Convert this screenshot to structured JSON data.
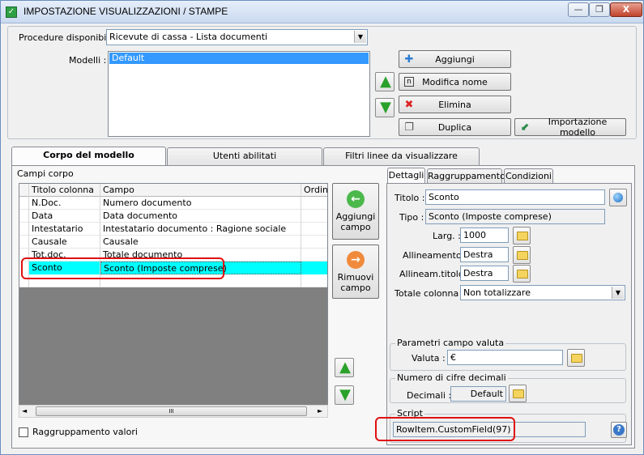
{
  "window": {
    "title": "IMPOSTAZIONE VISUALIZZAZIONI / STAMPE",
    "minimize_glyph": "—",
    "restore_glyph": "❐",
    "close_glyph": "X"
  },
  "top": {
    "procedure_label": "Procedure disponibili :",
    "procedure_value": "Ricevute di cassa - Lista documenti",
    "models_label": "Modelli :",
    "models": [
      "Default"
    ],
    "buttons": {
      "add": "Aggiungi",
      "rename": "Modifica nome",
      "delete": "Elimina",
      "duplicate": "Duplica",
      "import": "Importazione modello"
    }
  },
  "tabs": [
    "Corpo del modello",
    "Utenti abilitati",
    "Filtri linee da visualizzare"
  ],
  "body": {
    "fields_label": "Campi corpo",
    "columns": [
      "Titolo colonna",
      "Campo",
      "Ordina"
    ],
    "rows": [
      {
        "title": "N.Doc.",
        "field": "Numero documento"
      },
      {
        "title": "Data",
        "field": "Data documento"
      },
      {
        "title": "Intestatario",
        "field": "Intestatario documento : Ragione sociale"
      },
      {
        "title": "Causale",
        "field": "Causale"
      },
      {
        "title": "Tot.doc.",
        "field": "Totale documento"
      },
      {
        "title": "Sconto",
        "field": "Sconto (Imposte comprese)"
      }
    ],
    "add_field_line1": "Aggiungi",
    "add_field_line2": "campo",
    "remove_field_line1": "Rimuovi",
    "remove_field_line2": "campo",
    "group_values_label": "Raggruppamento valori",
    "scroll_grip": "III"
  },
  "details": {
    "tabs": [
      "Dettagli",
      "Raggruppamento",
      "Condizioni"
    ],
    "title_label": "Titolo :",
    "title_value": "Sconto",
    "type_label": "Tipo :",
    "type_value": "Sconto (Imposte comprese)",
    "width_label": "Larg. :",
    "width_value": "1000",
    "align_label": "Allineamento :",
    "align_value": "Destra",
    "title_align_label": "Allineam.titolo :",
    "title_align_value": "Destra",
    "total_label": "Totale colonna :",
    "total_value": "Non totalizzare",
    "currency_group": "Parametri campo valuta",
    "currency_label": "Valuta :",
    "currency_value": "€",
    "decimals_group": "Numero di cifre decimali",
    "decimals_label": "Decimali :",
    "decimals_value": "Default",
    "script_group": "Script",
    "script_value": "RowItem.CustomField(97)"
  }
}
